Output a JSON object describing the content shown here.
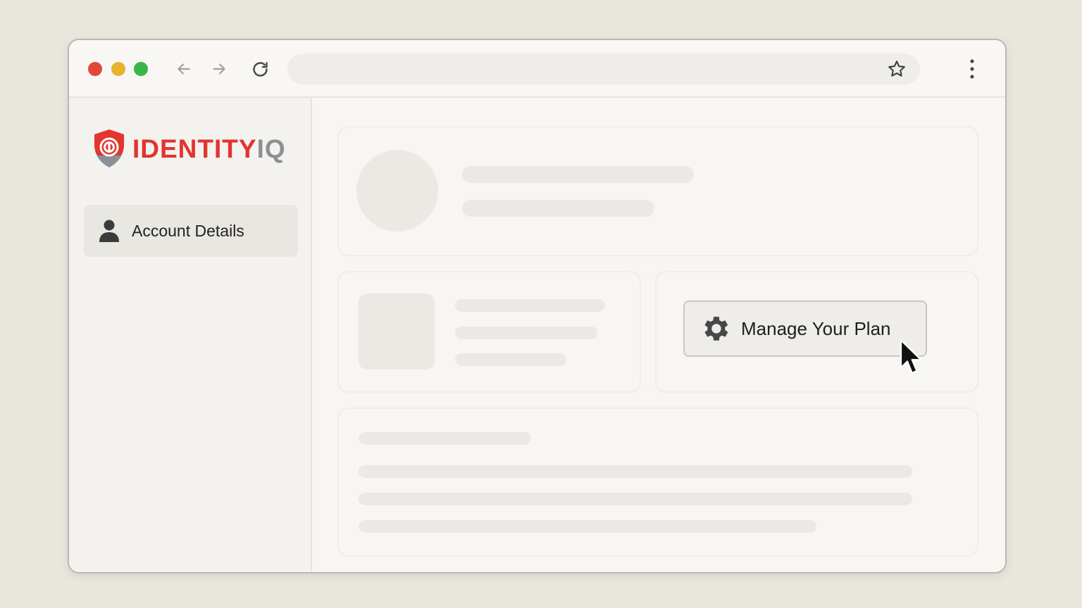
{
  "browser": {
    "window_controls": [
      "close",
      "minimize",
      "maximize"
    ],
    "colors": {
      "close": "#e2473b",
      "minimize": "#e8b22c",
      "maximize": "#39b54a"
    },
    "nav_icons": [
      "back-arrow-icon",
      "forward-arrow-icon",
      "reload-icon",
      "star-icon",
      "more-vertical-icon"
    ],
    "address_bar_value": ""
  },
  "sidebar": {
    "logo": {
      "part1": "IDENTITY",
      "part2": "IQ",
      "colors": {
        "red": "#e3342f",
        "gray": "#8b9096"
      }
    },
    "items": [
      {
        "label": "Account Details",
        "icon": "person-icon"
      }
    ]
  },
  "main": {
    "manage_plan_button": {
      "label": "Manage Your Plan",
      "icon": "gear-icon"
    }
  },
  "cursor": {
    "type": "arrow-pointer"
  }
}
